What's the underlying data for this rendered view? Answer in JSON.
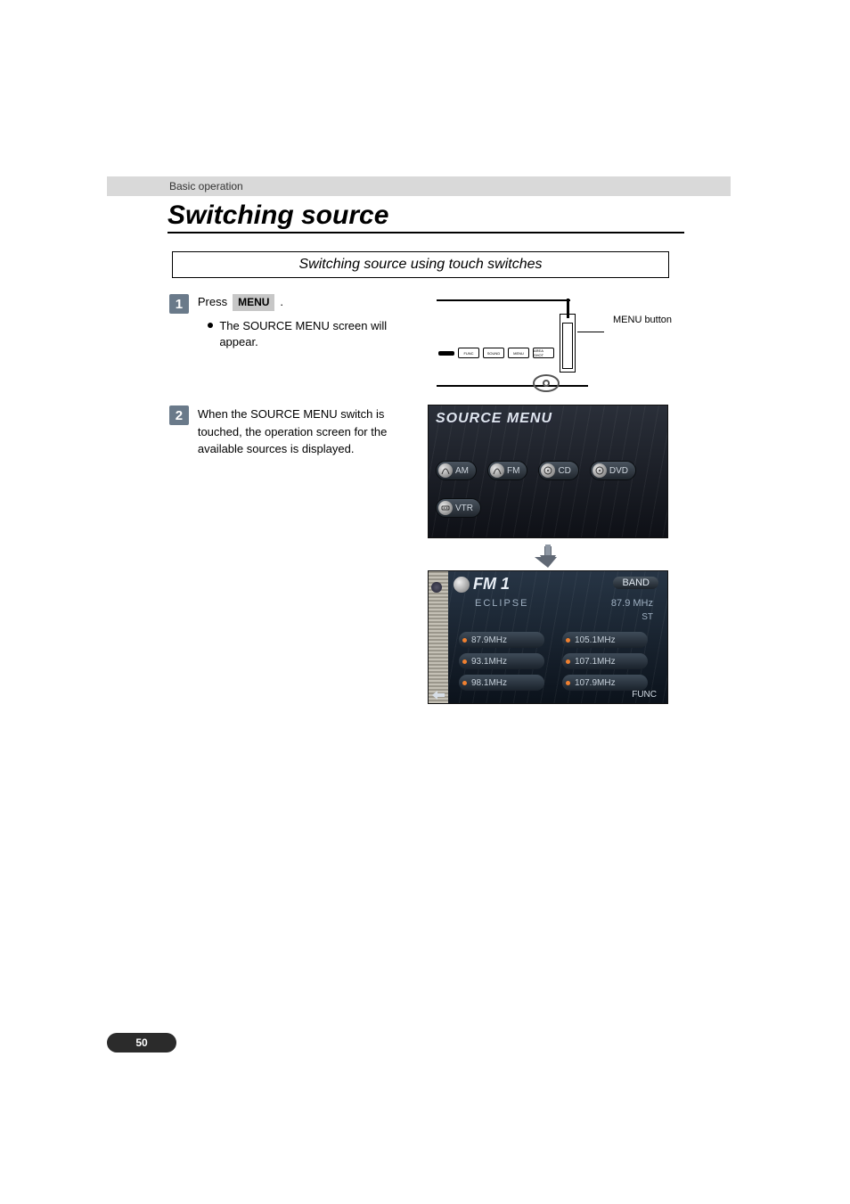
{
  "header": {
    "category": "Basic operation"
  },
  "title": "Switching source",
  "section_heading": "Switching source using touch switches",
  "steps": {
    "s1": {
      "num": "1",
      "press_word": "Press",
      "press_button": "MENU",
      "period": ".",
      "sub": "The SOURCE MENU screen will appear."
    },
    "s2": {
      "num": "2",
      "text": "When the SOURCE MENU switch is touched, the operation screen for the available sources is displayed."
    }
  },
  "device": {
    "buttons": [
      "FUNC",
      "SOUND",
      "MENU",
      "AREA SHOT"
    ],
    "callout": "MENU button"
  },
  "source_menu": {
    "title": "SOURCE MENU",
    "items": [
      "AM",
      "FM",
      "CD",
      "DVD",
      "VTR"
    ]
  },
  "fm_screen": {
    "title": "FM 1",
    "band_label": "BAND",
    "station_name": "ECLIPSE",
    "current_freq": "87.9 MHz",
    "stereo": "ST",
    "presets": [
      "87.9MHz",
      "105.1MHz",
      "93.1MHz",
      "107.1MHz",
      "98.1MHz",
      "107.9MHz"
    ],
    "func_label": "FUNC"
  },
  "page_number": "50"
}
